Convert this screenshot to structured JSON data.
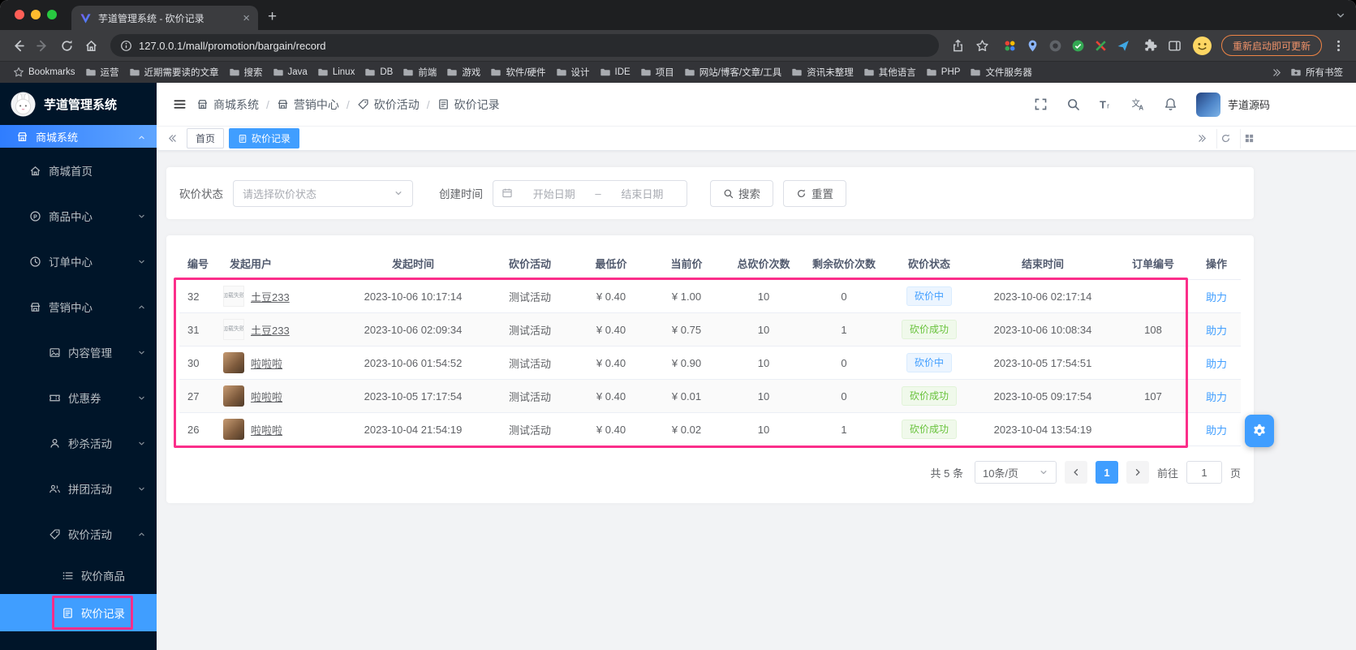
{
  "browser": {
    "tab_title": "芋道管理系统 - 砍价记录",
    "url": "127.0.0.1/mall/promotion/bargain/record",
    "update_button": "重新启动即可更新",
    "bookmarks_label": "Bookmarks",
    "bookmarks": [
      "运营",
      "近期需要读的文章",
      "搜索",
      "Java",
      "Linux",
      "DB",
      "前端",
      "游戏",
      "软件/硬件",
      "设计",
      "IDE",
      "项目",
      "网站/博客/文章/工具",
      "资讯未整理",
      "其他语言",
      "PHP",
      "文件服务器"
    ],
    "all_bookmarks_label": "所有书签"
  },
  "app": {
    "logo_title": "芋道管理系统",
    "header": {
      "breadcrumb": [
        {
          "label": "商城系统",
          "icon": "shop"
        },
        {
          "label": "营销中心",
          "icon": "marketing"
        },
        {
          "label": "砍价活动",
          "icon": "bargain"
        },
        {
          "label": "砍价记录",
          "icon": "record"
        }
      ],
      "username": "芋道源码"
    },
    "sidebar": [
      {
        "label": "商城系统",
        "icon": "shop",
        "level": 0,
        "active_root": true,
        "chevron": "up"
      },
      {
        "label": "商城首页",
        "icon": "home",
        "level": 1
      },
      {
        "label": "商品中心",
        "icon": "product",
        "level": 1,
        "chevron": "down"
      },
      {
        "label": "订单中心",
        "icon": "order",
        "level": 1,
        "chevron": "down"
      },
      {
        "label": "营销中心",
        "icon": "marketing",
        "level": 1,
        "chevron": "up"
      },
      {
        "label": "内容管理",
        "icon": "content",
        "level": 2,
        "chevron": "down"
      },
      {
        "label": "优惠券",
        "icon": "coupon",
        "level": 2,
        "chevron": "down"
      },
      {
        "label": "秒杀活动",
        "icon": "seckill",
        "level": 2,
        "chevron": "down"
      },
      {
        "label": "拼团活动",
        "icon": "groupon",
        "level": 2,
        "chevron": "down"
      },
      {
        "label": "砍价活动",
        "icon": "bargain",
        "level": 2,
        "chevron": "up"
      },
      {
        "label": "砍价商品",
        "icon": "goods",
        "level": 3
      },
      {
        "label": "砍价记录",
        "icon": "record",
        "level": 3,
        "active": true,
        "annotated": true
      }
    ],
    "tags": [
      {
        "label": "首页",
        "active": false
      },
      {
        "label": "砍价记录",
        "active": true,
        "icon": "record"
      }
    ],
    "filter": {
      "status_label": "砍价状态",
      "status_placeholder": "请选择砍价状态",
      "time_label": "创建时间",
      "start_placeholder": "开始日期",
      "range_separator": "–",
      "end_placeholder": "结束日期",
      "search_label": "搜索",
      "reset_label": "重置"
    },
    "table": {
      "columns": [
        "编号",
        "发起用户",
        "发起时间",
        "砍价活动",
        "最低价",
        "当前价",
        "总砍价次数",
        "剩余砍价次数",
        "砍价状态",
        "结束时间",
        "订单编号",
        "操作"
      ],
      "broken_avatar_text": "加载失败",
      "rows": [
        {
          "id": "32",
          "user": "土豆233",
          "avatar": "broken",
          "start_time": "2023-10-06 10:17:14",
          "activity": "测试活动",
          "min_price": "¥ 0.40",
          "cur_price": "¥ 1.00",
          "total": "10",
          "remain": "0",
          "status": "砍价中",
          "status_type": "processing",
          "end_time": "2023-10-06 02:17:14",
          "order": "",
          "action": "助力"
        },
        {
          "id": "31",
          "user": "土豆233",
          "avatar": "broken",
          "start_time": "2023-10-06 02:09:34",
          "activity": "测试活动",
          "min_price": "¥ 0.40",
          "cur_price": "¥ 0.75",
          "total": "10",
          "remain": "1",
          "status": "砍价成功",
          "status_type": "success",
          "end_time": "2023-10-06 10:08:34",
          "order": "108",
          "action": "助力"
        },
        {
          "id": "30",
          "user": "啦啦啦",
          "avatar": "photo",
          "start_time": "2023-10-06 01:54:52",
          "activity": "测试活动",
          "min_price": "¥ 0.40",
          "cur_price": "¥ 0.90",
          "total": "10",
          "remain": "0",
          "status": "砍价中",
          "status_type": "processing",
          "end_time": "2023-10-05 17:54:51",
          "order": "",
          "action": "助力"
        },
        {
          "id": "27",
          "user": "啦啦啦",
          "avatar": "photo",
          "start_time": "2023-10-05 17:17:54",
          "activity": "测试活动",
          "min_price": "¥ 0.40",
          "cur_price": "¥ 0.01",
          "total": "10",
          "remain": "0",
          "status": "砍价成功",
          "status_type": "success",
          "end_time": "2023-10-05 09:17:54",
          "order": "107",
          "action": "助力"
        },
        {
          "id": "26",
          "user": "啦啦啦",
          "avatar": "photo",
          "start_time": "2023-10-04 21:54:19",
          "activity": "测试活动",
          "min_price": "¥ 0.40",
          "cur_price": "¥ 0.02",
          "total": "10",
          "remain": "1",
          "status": "砍价成功",
          "status_type": "success",
          "end_time": "2023-10-04 13:54:19",
          "order": "",
          "action": "助力"
        }
      ]
    },
    "pagination": {
      "total": "共 5 条",
      "page_size": "10条/页",
      "current_page": "1",
      "goto_label": "前往",
      "goto_value": "1",
      "page_unit": "页"
    }
  },
  "colors": {
    "accent": "#409eff",
    "annotation": "#fb2e8a",
    "status-processing-bg": "#ecf5ff",
    "status-processing-text": "#409eff",
    "status-success-bg": "#f0f9eb",
    "status-success-text": "#67c23a"
  }
}
